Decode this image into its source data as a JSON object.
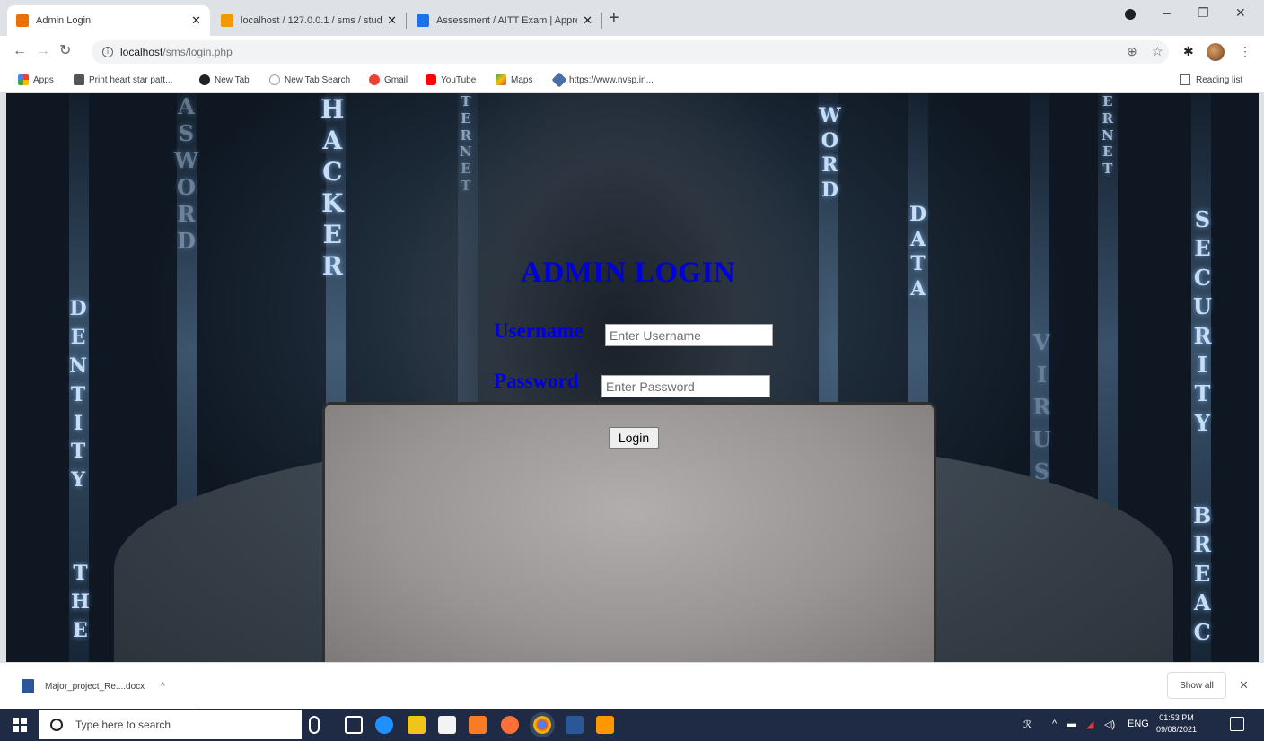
{
  "tabs": [
    {
      "title": "Admin Login",
      "active": true,
      "favicon_color": "#e8710a"
    },
    {
      "title": "localhost / 127.0.0.1 / sms / stud",
      "active": false,
      "favicon_color": "#f29900"
    },
    {
      "title": "Assessment / AITT Exam | Appre",
      "active": false,
      "favicon_color": "#1a73e8"
    }
  ],
  "window": {
    "minimize": "–",
    "maximize": "❐",
    "close": "✕"
  },
  "toolbar": {
    "url_host": "localhost",
    "url_path": "/sms/login.php"
  },
  "bookmarks": [
    {
      "label": "Apps",
      "color": "#ea4335"
    },
    {
      "label": "Print heart star patt...",
      "color": "#555555"
    },
    {
      "label": "New Tab",
      "color": "#202124"
    },
    {
      "label": "New Tab Search",
      "color": "#9aa0a6"
    },
    {
      "label": "Gmail",
      "color": "#ea4335"
    },
    {
      "label": "YouTube",
      "color": "#ff0000"
    },
    {
      "label": "Maps",
      "color": "#34a853"
    },
    {
      "label": "https://www.nvsp.in...",
      "color": "#4a6fa5"
    }
  ],
  "reading_list": "Reading list",
  "background_words": [
    "HACKER",
    "WORD",
    "DATA",
    "SECURITY",
    "PASSWORD",
    "IDENTITY",
    "INTERNET",
    "VIRUS",
    "ERNET",
    "BREAC",
    "THE"
  ],
  "login": {
    "title": "ADMIN LOGIN",
    "username_label": "Username",
    "username_placeholder": "Enter Username",
    "password_label": "Password",
    "password_placeholder": "Enter Password",
    "button": "Login",
    "accent_color": "#0000d8"
  },
  "downloads": {
    "file": "Major_project_Re....docx",
    "show_all": "Show all"
  },
  "taskbar": {
    "search_placeholder": "Type here to search",
    "language": "ENG",
    "time": "01:53 PM",
    "date": "09/08/2021"
  }
}
